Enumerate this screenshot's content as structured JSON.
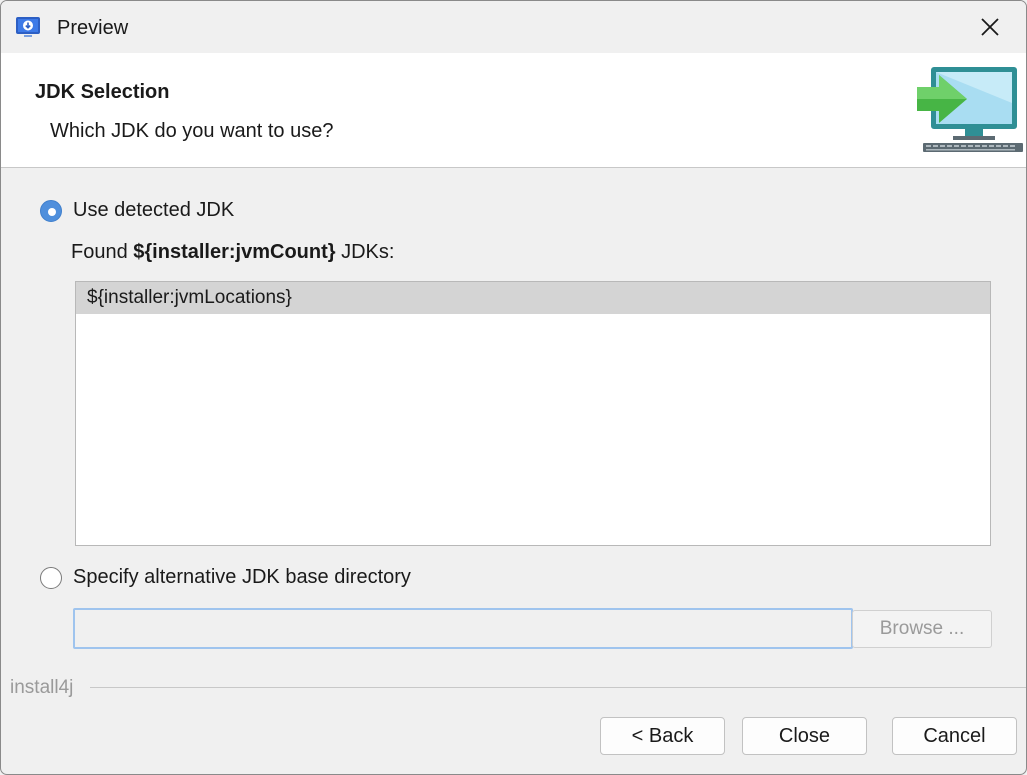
{
  "window": {
    "title": "Preview"
  },
  "icons": {
    "app": "installer-app-icon",
    "close": "close-icon",
    "banner": "computer-install-icon"
  },
  "header": {
    "title": "JDK Selection",
    "subtitle": "Which JDK do you want to use?"
  },
  "detected": {
    "label": "Use detected JDK",
    "selected": true,
    "found_prefix": "Found ",
    "found_count": "${installer:jvmCount}",
    "found_suffix": " JDKs:",
    "list_items": [
      "${installer:jvmLocations}"
    ]
  },
  "alternative": {
    "label": "Specify alternative JDK base directory",
    "selected": false,
    "input_value": "",
    "browse_label": "Browse ..."
  },
  "footer": {
    "brand": "install4j",
    "back_label": "< Back",
    "close_label": "Close",
    "cancel_label": "Cancel"
  },
  "colors": {
    "accent": "#4f8fdc",
    "input_focus": "#9fc4ee",
    "selected_row": "#d4d4d4"
  }
}
